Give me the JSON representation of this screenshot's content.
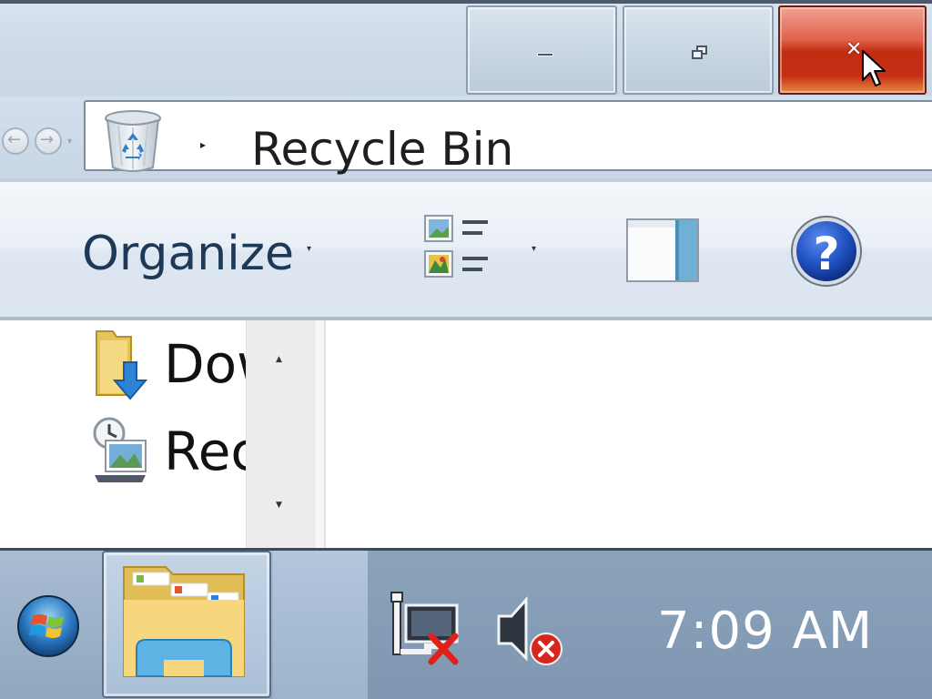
{
  "window": {
    "caption_buttons": {
      "minimize": "minimize",
      "restore": "restore",
      "close": "close"
    },
    "nav": {
      "back_icon": "back-arrow-icon",
      "forward_icon": "forward-arrow-icon"
    },
    "address": {
      "location_icon": "recycle-bin-icon",
      "separator": "▸",
      "path": "Recycle Bin"
    }
  },
  "commandbar": {
    "organize_label": "Organize",
    "organize_caret": "▾",
    "views_caret": "▾",
    "views_icon": "change-view-icon",
    "preview_icon": "preview-pane-icon",
    "help_icon": "help-icon"
  },
  "navpane": {
    "items": [
      {
        "label": "Downloads",
        "icon": "downloads-folder-icon"
      },
      {
        "label": "Recent Places",
        "icon": "recent-places-icon"
      }
    ],
    "scroll_up": "▲",
    "scroll_down": "▼"
  },
  "taskbar": {
    "start_icon": "windows-start-icon",
    "pinned": [
      {
        "app": "Windows Explorer",
        "icon": "explorer-folder-icon"
      }
    ],
    "tray": {
      "network_icon": "network-disconnected-icon",
      "volume_icon": "volume-error-icon",
      "clock": "7:09 AM"
    }
  },
  "colors": {
    "close_red": "#c32c12",
    "text_dark": "#1e3958",
    "taskbar": "#8fa7c0"
  }
}
